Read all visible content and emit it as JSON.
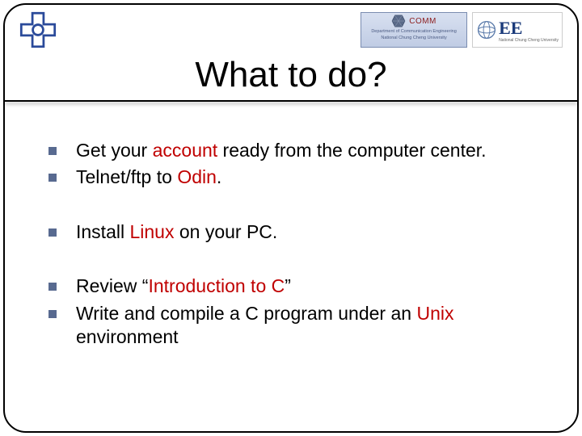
{
  "header": {
    "comm_label": "COMM",
    "comm_sub1": "Department of Communication Engineering",
    "comm_sub2": "National Chung Cheng University",
    "ee_text": "EE",
    "ee_sub": "National Chung Cheng University"
  },
  "title": "What to do?",
  "bullets": [
    {
      "pre": "Get your ",
      "hl": "account",
      "post": " ready from the computer center."
    },
    {
      "pre": "Telnet/ftp to ",
      "hl": "Odin",
      "post": "."
    },
    {
      "pre": "Install ",
      "hl": "Linux",
      "post": " on your PC."
    },
    {
      "pre": "Review “",
      "hl": "Introduction to C",
      "post": "”"
    },
    {
      "pre": "Write and compile a C program under an ",
      "hl": "Unix",
      "post": " environment"
    }
  ]
}
